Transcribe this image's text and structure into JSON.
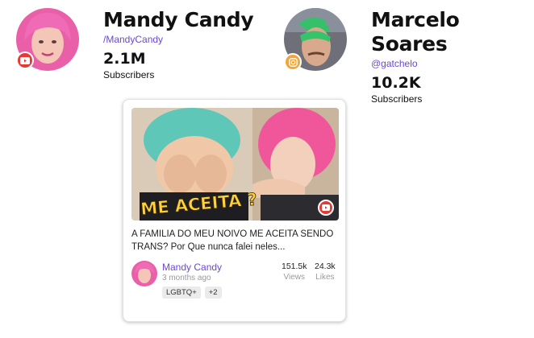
{
  "creators": [
    {
      "name": "Mandy Candy",
      "handle": "/MandyCandy",
      "count": "2.1M",
      "count_label": "Subscribers",
      "platform": "youtube-icon"
    },
    {
      "name": "Marcelo Soares",
      "handle": "@gatchelo",
      "count": "10.2K",
      "count_label": "Subscribers",
      "platform": "instagram-icon"
    }
  ],
  "video_card": {
    "thumbnail_caption": "ME ACEITA ?",
    "title": "A FAMILIA DO MEU NOIVO ME ACEITA SENDO TRANS? Por Que nunca falei neles...",
    "creator": "Mandy Candy",
    "time": "3 months ago",
    "views_value": "151.5k",
    "views_label": "Views",
    "likes_value": "24.3k",
    "likes_label": "Likes",
    "tags": [
      "LGBTQ+",
      "+2"
    ],
    "platform": "youtube-icon"
  },
  "colors": {
    "accent": "#6c47d6",
    "youtube": "#e53935",
    "instagram": "#f2a53a"
  }
}
